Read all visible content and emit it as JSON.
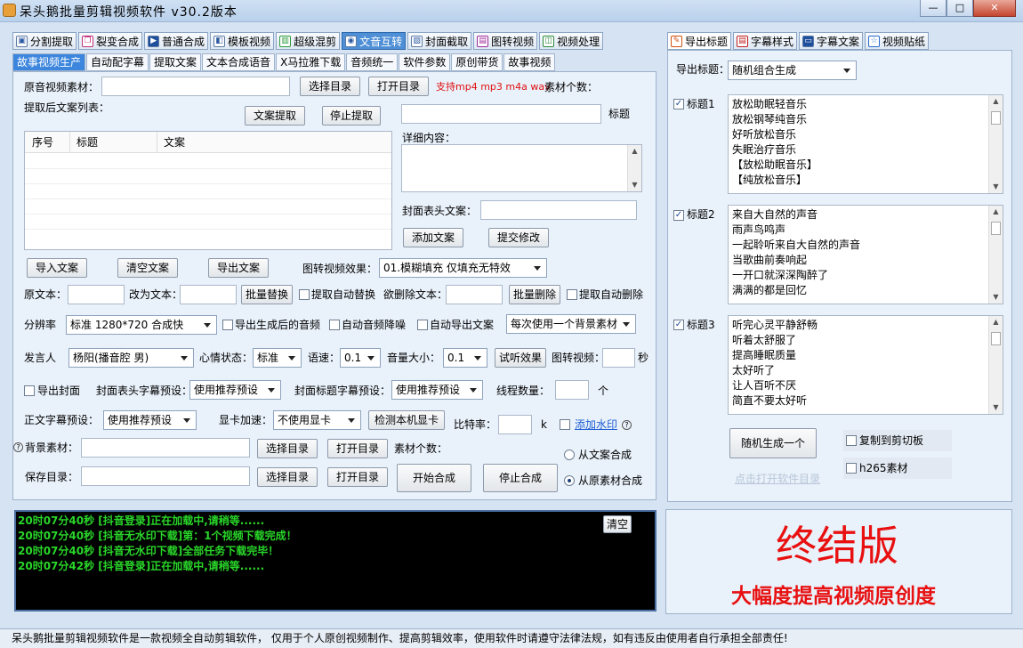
{
  "app": {
    "title": "呆头鹅批量剪辑视频软件   v30.2版本"
  },
  "main_tabs": [
    {
      "label": "分割提取",
      "icon": "video-icon"
    },
    {
      "label": "裂变合成",
      "icon": "copy-icon"
    },
    {
      "label": "普通合成",
      "icon": "play-icon"
    },
    {
      "label": "模板视频",
      "icon": "film-icon"
    },
    {
      "label": "超级混剪",
      "icon": "bars-icon"
    },
    {
      "label": "文音互转",
      "icon": "mic-icon"
    },
    {
      "label": "封面截取",
      "icon": "image-icon"
    },
    {
      "label": "图转视频",
      "icon": "picture-icon"
    },
    {
      "label": "视频处理",
      "icon": "process-icon"
    }
  ],
  "sub_tabs": [
    "故事视频生产",
    "自动配字幕",
    "提取文案",
    "文本合成语音",
    "X马拉雅下载",
    "音频统一",
    "软件参数",
    "原创带货",
    "故事视频"
  ],
  "form": {
    "source_label": "原音视频素材：",
    "select_dir": "选择目录",
    "open_dir": "打开目录",
    "supported": "支持mp4 mp3 m4a wav",
    "material_count": "素材个数：",
    "extract_list": "提取后文案列表：",
    "extract_btn": "文案提取",
    "stop_extract": "停止提取",
    "table_headers": [
      "序号",
      "标题",
      "文案"
    ],
    "title_label": "标题",
    "detail_label": "详细内容：",
    "cover_label": "封面表头文案：",
    "add_text": "添加文案",
    "submit_edit": "提交修改",
    "import_text": "导入文案",
    "clear_text": "清空文案",
    "export_text": "导出文案",
    "img_effect_label": "图转视频效果：",
    "img_effect": "01.模糊填充 仅填充无特效",
    "orig_text": "原文本：",
    "change_to": "改为文本：",
    "batch_replace": "批量替换",
    "auto_replace": "提取自动替换",
    "delete_text": "欲删除文本：",
    "batch_delete": "批量删除",
    "auto_delete": "提取自动删除",
    "resolution_label": "分辨率",
    "resolution": "标准 1280*720 合成快",
    "export_audio": "导出生成后的音频",
    "auto_denoise": "自动音频降噪",
    "auto_export": "自动导出文案",
    "bg_mode": "每次使用一个背景素材",
    "speaker_label": "发言人",
    "speaker": "杨阳(播音腔 男)",
    "mood_label": "心情状态：",
    "mood": "标准",
    "speed_label": "语速：",
    "speed": "0.1",
    "volume_label": "音量大小：",
    "volume": "0.1",
    "try_effect": "试听效果",
    "img_video_label": "图转视频：",
    "seconds": "秒",
    "export_cover": "导出封面",
    "cover_head_preset_label": "封面表头字幕预设：",
    "cover_head_preset": "使用推荐预设",
    "cover_title_preset_label": "封面标题字幕预设：",
    "cover_title_preset": "使用推荐预设",
    "threads_label": "线程数量：",
    "threads_unit": "个",
    "body_preset_label": "正文字幕预设：",
    "body_preset": "使用推荐预设",
    "gpu_label": "显卡加速：",
    "gpu": "不使用显卡",
    "detect_gpu": "检测本机显卡",
    "bitrate_label": "比特率：",
    "bitrate_unit": "k",
    "add_watermark": "添加水印",
    "bg_label": "背景素材：",
    "select_dir2": "选择目录",
    "open_dir2": "打开目录",
    "material_count2": "素材个数：",
    "save_label": "保存目录：",
    "select_dir3": "选择目录",
    "open_dir3": "打开目录",
    "start": "开始合成",
    "stop": "停止合成",
    "from_text": "从文案合成",
    "from_source": "从原素材合成"
  },
  "right_tabs": [
    "导出标题",
    "字幕样式",
    "字幕文案",
    "视频贴纸"
  ],
  "right": {
    "export_title_label": "导出标题：",
    "export_title_mode": "随机组合生成",
    "titles": [
      {
        "label": "标题1",
        "lines": [
          "放松助眠轻音乐",
          "放松钢琴纯音乐",
          "好听放松音乐",
          "失眠治疗音乐",
          "【放松助眠音乐】",
          "【纯放松音乐】"
        ]
      },
      {
        "label": "标题2",
        "lines": [
          "来自大自然的声音",
          "雨声鸟鸣声",
          "一起聆听来自大自然的声音",
          "当歌曲前奏响起",
          "一开口就深深陶醉了",
          "满满的都是回忆"
        ]
      },
      {
        "label": "标题3",
        "lines": [
          "听完心灵平静舒畅",
          "听着太舒服了",
          "提高睡眠质量",
          "太好听了",
          "让人百听不厌",
          "简直不要太好听"
        ]
      }
    ],
    "random_btn": "随机生成一个",
    "copy_clipboard": "复制到剪切板",
    "h265": "h265素材",
    "open_dir_link": "点击打开软件目录",
    "promo_title": "终结版",
    "promo_sub": "大幅度提高视频原创度"
  },
  "log": {
    "clear": "清空",
    "lines": [
      "20时07分40秒 [抖音登录]正在加载中,请稍等......",
      "20时07分40秒 [抖音无水印下载]第：1个视频下载完成！",
      "20时07分40秒 [抖音无水印下载]全部任务下载完毕！",
      "20时07分42秒 [抖音登录]正在加载中,请稍等......"
    ]
  },
  "status": "呆头鹅批量剪辑视频软件是一款视频全自动剪辑软件， 仅用于个人原创视频制作、提高剪辑效率，使用软件时请遵守法律法规，如有违反由使用者自行承担全部责任!"
}
